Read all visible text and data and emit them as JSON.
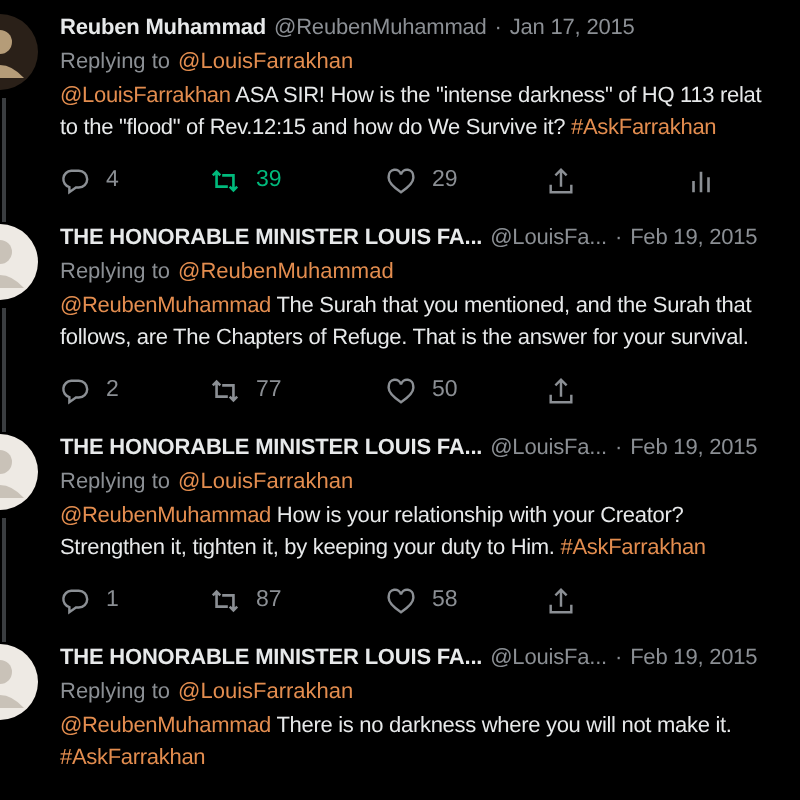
{
  "tweets": [
    {
      "name": "Reuben Muhammad",
      "handle": "@ReubenMuhammad",
      "dot": "·",
      "date": "Jan 17, 2015",
      "replying_label": "Replying to",
      "replying_to": "@LouisFarrakhan",
      "lines": [
        [
          {
            "kind": "mention",
            "text": "@LouisFarrakhan"
          },
          {
            "kind": "text",
            "text": " ASA SIR! How is the \"intense darkness\" of HQ 113 relat"
          }
        ],
        [
          {
            "kind": "text",
            "text": "to the \"flood\" of Rev.12:15 and how do We Survive it? "
          },
          {
            "kind": "hashtag",
            "text": "#AskFarrakhan"
          }
        ]
      ],
      "replies": "4",
      "retweets": "39",
      "retweeted": true,
      "likes": "29",
      "analytics": true
    },
    {
      "name": "THE HONORABLE MINISTER LOUIS FA...",
      "handle": "@LouisFa...",
      "dot": "·",
      "date": "Feb 19, 2015",
      "replying_label": "Replying to",
      "replying_to": "@ReubenMuhammad",
      "lines": [
        [
          {
            "kind": "mention",
            "text": "@ReubenMuhammad"
          },
          {
            "kind": "text",
            "text": " The Surah that you mentioned, and the Surah that"
          }
        ],
        [
          {
            "kind": "text",
            "text": "follows, are The Chapters of Refuge. That is the answer for your survival."
          }
        ]
      ],
      "replies": "2",
      "retweets": "77",
      "retweeted": false,
      "likes": "50",
      "analytics": false
    },
    {
      "name": "THE HONORABLE MINISTER LOUIS FA...",
      "handle": "@LouisFa...",
      "dot": "·",
      "date": "Feb 19, 2015",
      "replying_label": "Replying to",
      "replying_to": "@LouisFarrakhan",
      "lines": [
        [
          {
            "kind": "mention",
            "text": "@ReubenMuhammad"
          },
          {
            "kind": "text",
            "text": " How is your relationship with your Creator?"
          }
        ],
        [
          {
            "kind": "text",
            "text": "Strengthen it, tighten it, by keeping your duty to Him. "
          },
          {
            "kind": "hashtag",
            "text": "#AskFarrakhan"
          }
        ]
      ],
      "replies": "1",
      "retweets": "87",
      "retweeted": false,
      "likes": "58",
      "analytics": false
    },
    {
      "name": "THE HONORABLE MINISTER LOUIS FA...",
      "handle": "@LouisFa...",
      "dot": "·",
      "date": "Feb 19, 2015",
      "replying_label": "Replying to",
      "replying_to": "@LouisFarrakhan",
      "lines": [
        [
          {
            "kind": "mention",
            "text": "@ReubenMuhammad"
          },
          {
            "kind": "text",
            "text": " There is no darkness where you will not make it."
          }
        ],
        [
          {
            "kind": "hashtag",
            "text": "#AskFarrakhan"
          }
        ]
      ]
    }
  ]
}
